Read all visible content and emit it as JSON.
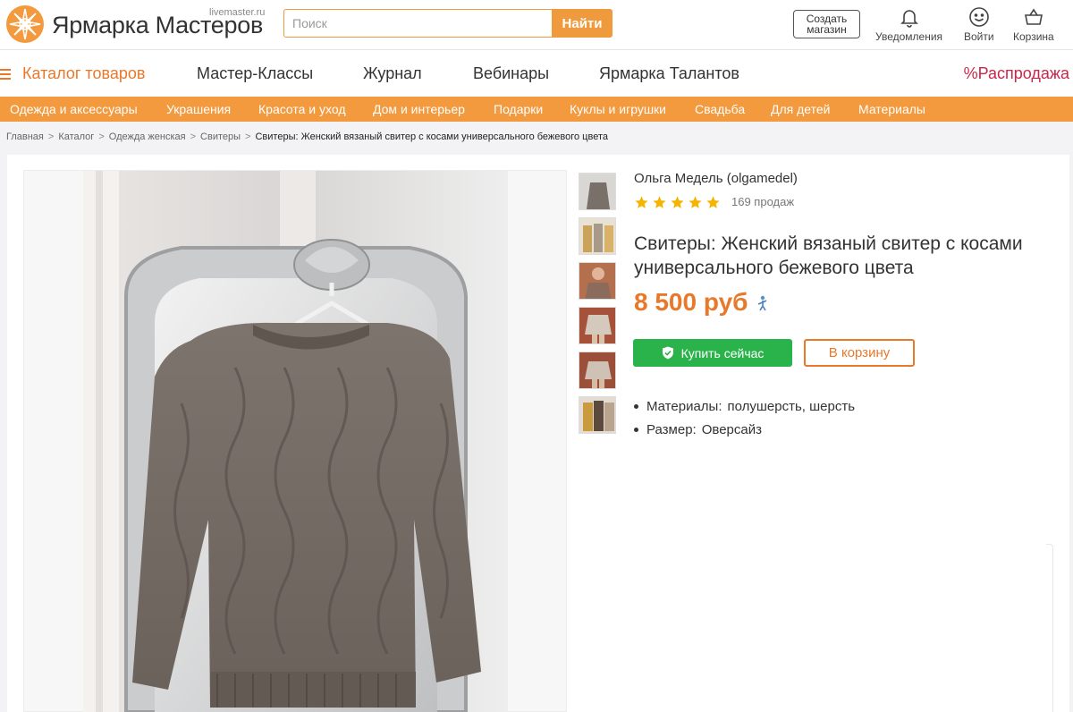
{
  "header": {
    "logo_text": "Ярмарка Мастеров",
    "logo_domain": "livemaster.ru",
    "search": {
      "placeholder": "Поиск",
      "value": "",
      "button_label": "Найти"
    },
    "create_shop_label": "Создать\nмагазин",
    "actions": [
      {
        "label": "Уведомления",
        "icon": "bell-icon"
      },
      {
        "label": "Войти",
        "icon": "smile-icon"
      },
      {
        "label": "Корзина",
        "icon": "basket-icon"
      }
    ]
  },
  "main_nav": {
    "catalog_label": "Каталог товаров",
    "items": [
      "Мастер-Классы",
      "Журнал",
      "Вебинары",
      "Ярмарка Талантов"
    ],
    "sale_label": "%Распродажа"
  },
  "category_bar": {
    "items": [
      "Одежда и аксессуары",
      "Украшения",
      "Красота и уход",
      "Дом и интерьер",
      "Подарки",
      "Куклы и игрушки",
      "Свадьба",
      "Для детей",
      "Материалы"
    ]
  },
  "breadcrumb": {
    "items": [
      "Главная",
      "Каталог",
      "Одежда женская",
      "Свитеры"
    ],
    "separator": ">",
    "current": "Свитеры: Женский вязаный свитер с косами универсального бежевого цвета"
  },
  "product": {
    "seller": "Ольга Медель (olgamedel)",
    "rating": 5,
    "rating_max": 5,
    "sales": "169 продаж",
    "title": "Свитеры: Женский вязаный свитер с косами универсального бежевого цвета",
    "price": "8 500 руб",
    "buy_now_label": "Купить сейчас",
    "add_to_cart_label": "В корзину",
    "properties": [
      {
        "key": "Материалы:",
        "value": "полушерсть, шерсть"
      },
      {
        "key": "Размер:",
        "value": "Оверсайз"
      }
    ],
    "thumbnail_count": 6
  },
  "colors": {
    "brand_orange": "#f39a3e",
    "accent_orange": "#e8792b",
    "buy_green": "#2bb34b",
    "sale_red": "#c8274a",
    "star": "#f5b400"
  }
}
